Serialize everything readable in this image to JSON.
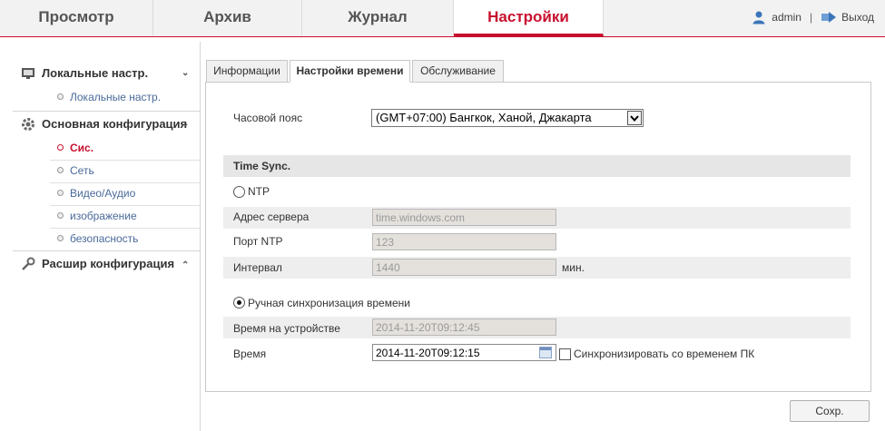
{
  "nav": {
    "tabs": [
      {
        "label": "Просмотр"
      },
      {
        "label": "Архив"
      },
      {
        "label": "Журнал"
      },
      {
        "label": "Настройки"
      }
    ],
    "user": "admin",
    "separator": "|",
    "logout": "Выход",
    "active_tab": "Настройки",
    "accent_color": "#c8102e"
  },
  "sidebar": {
    "local": {
      "title": "Локальные настр.",
      "icon": "monitor-icon",
      "items": [
        "Локальные настр."
      ]
    },
    "basic": {
      "title": "Основная конфигурация",
      "icon": "gear-icon",
      "items": [
        "Сис.",
        "Сеть",
        "Видео/Аудио",
        "изображение",
        "безопасность"
      ],
      "active": "Сис."
    },
    "advanced": {
      "title": "Расшир конфигурация",
      "icon": "wrench-icon"
    }
  },
  "tabs": [
    "Информации",
    "Настройки времени",
    "Обслуживание"
  ],
  "active_tab": "Настройки времени",
  "form": {
    "timezone_label": "Часовой пояс",
    "timezone_value": "(GMT+07:00) Бангкок, Ханой, Джакарта",
    "section_title": "Time Sync.",
    "ntp_label": "NTP",
    "ntp_selected": false,
    "server_label": "Адрес сервера",
    "server_value": "time.windows.com",
    "port_label": "Порт NTP",
    "port_value": "123",
    "interval_label": "Интервал",
    "interval_value": "1440",
    "interval_unit": "мин.",
    "manual_label": "Ручная синхронизация времени",
    "manual_selected": true,
    "device_time_label": "Время на устройстве",
    "device_time_value": "2014-11-20T09:12:45",
    "time_label": "Время",
    "time_value": "2014-11-20T09:12:15",
    "sync_pc_label": "Синхронизировать со временем ПК",
    "sync_pc_checked": false
  },
  "save_label": "Сохр."
}
